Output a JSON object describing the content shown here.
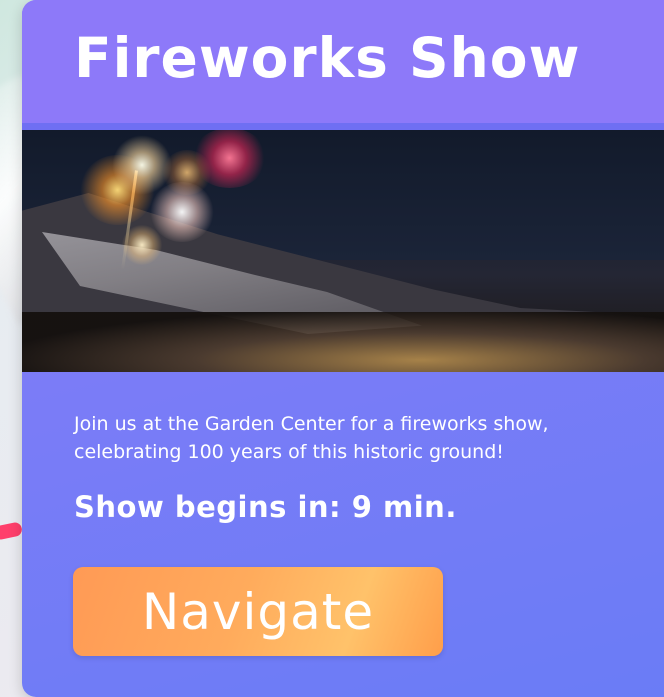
{
  "card": {
    "title": "Fireworks Show",
    "description": "Join us at the Garden Center for a fireworks show, celebrating 100 years of this historic ground!",
    "countdown": "Show begins in: 9 min.",
    "navigate_label": "Navigate"
  },
  "colors": {
    "header": "#8d79f9",
    "card_gradient_start": "#8a79f8",
    "card_gradient_end": "#6a7cf6",
    "button_gradient_start": "#ff9a55",
    "button_gradient_end": "#ffc26a",
    "text": "#ffffff"
  }
}
